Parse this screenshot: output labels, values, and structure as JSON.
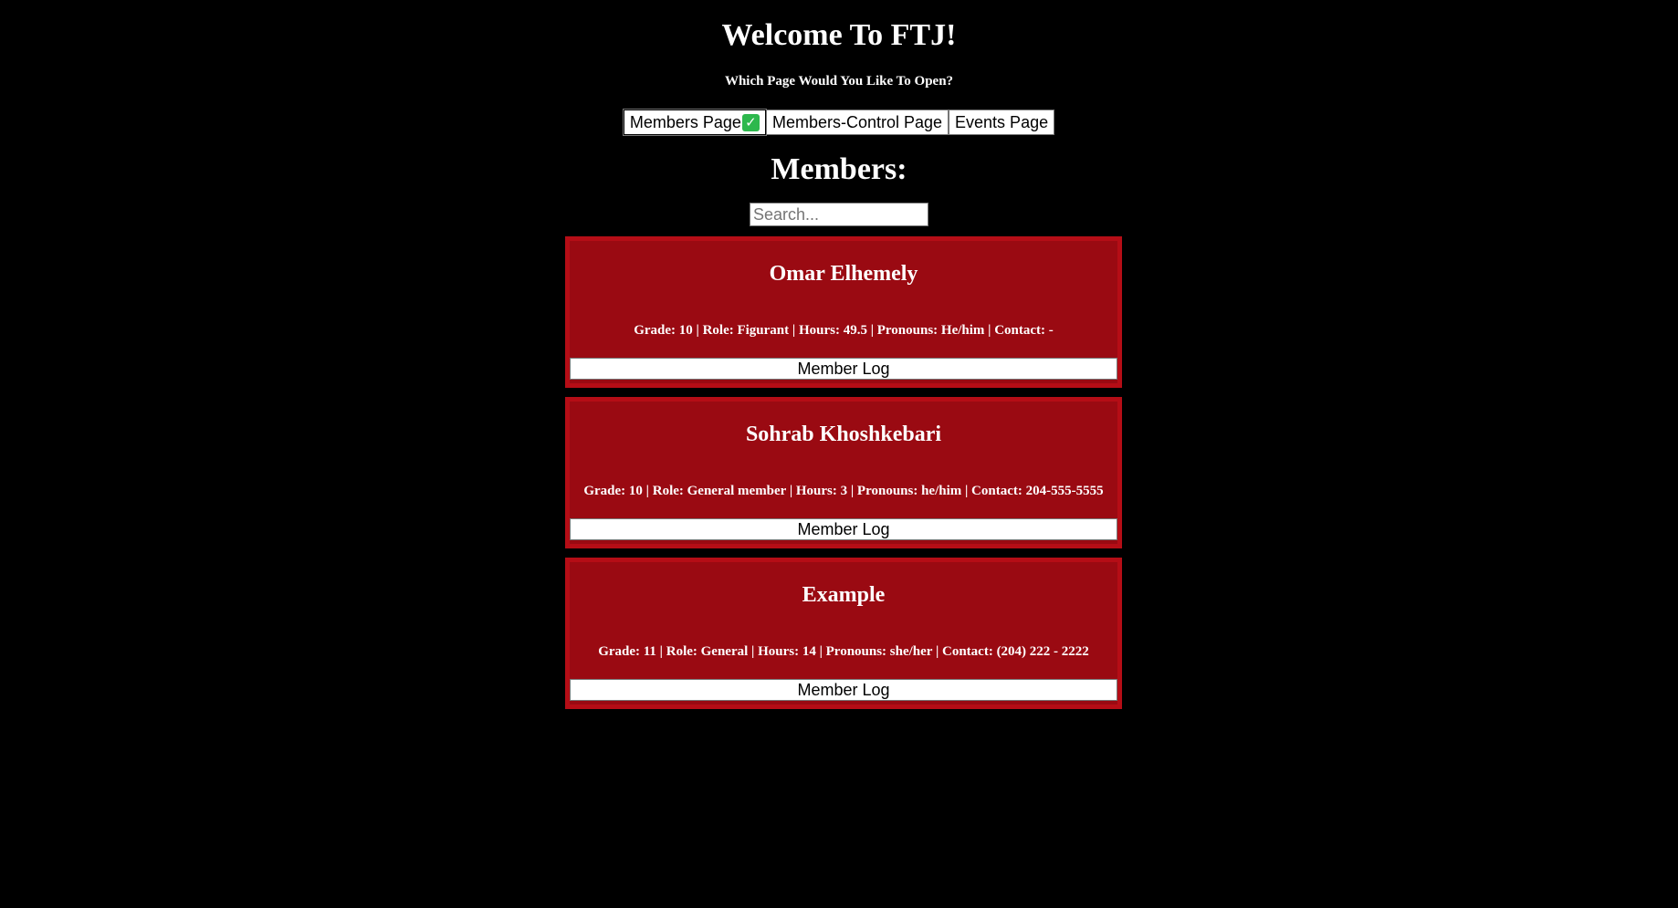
{
  "header": {
    "title": "Welcome To FTJ!",
    "subtitle": "Which Page Would You Like To Open?"
  },
  "nav": {
    "members_page": "Members Page",
    "members_page_check": "✓",
    "members_control_page": "Members-Control Page",
    "events_page": "Events Page"
  },
  "main": {
    "title": "Members:",
    "search_placeholder": "Search..."
  },
  "members": [
    {
      "name": "Omar Elhemely",
      "details": "Grade: 10 | Role: Figurant | Hours: 49.5 | Pronouns: He/him | Contact: -",
      "button": "Member Log"
    },
    {
      "name": "Sohrab Khoshkebari",
      "details": "Grade: 10 | Role: General member | Hours: 3 | Pronouns: he/him | Contact: 204-555-5555",
      "button": "Member Log"
    },
    {
      "name": "Example",
      "details": "Grade: 11 | Role: General | Hours: 14 | Pronouns: she/her | Contact: (204) 222 - 2222",
      "button": "Member Log"
    }
  ],
  "colors": {
    "background": "#000000",
    "card": "#9a0a12",
    "check_green": "#2db84d"
  }
}
